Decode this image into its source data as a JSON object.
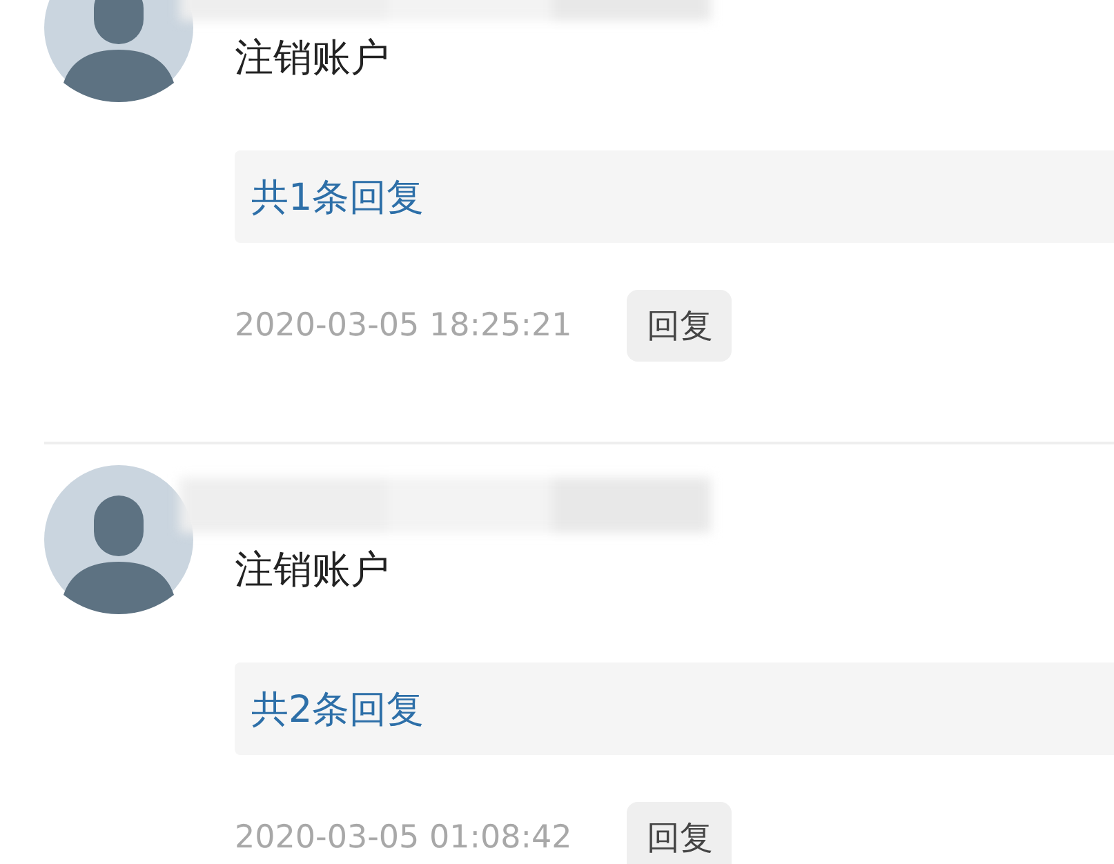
{
  "comments": [
    {
      "text": "注销账户",
      "replies_link": "共1条回复",
      "time": "2020-03-05 18:25:21",
      "reply_button": "回复"
    },
    {
      "text": "注销账户",
      "replies_link": "共2条回复",
      "time": "2020-03-05 01:08:42",
      "reply_button": "回复"
    }
  ]
}
